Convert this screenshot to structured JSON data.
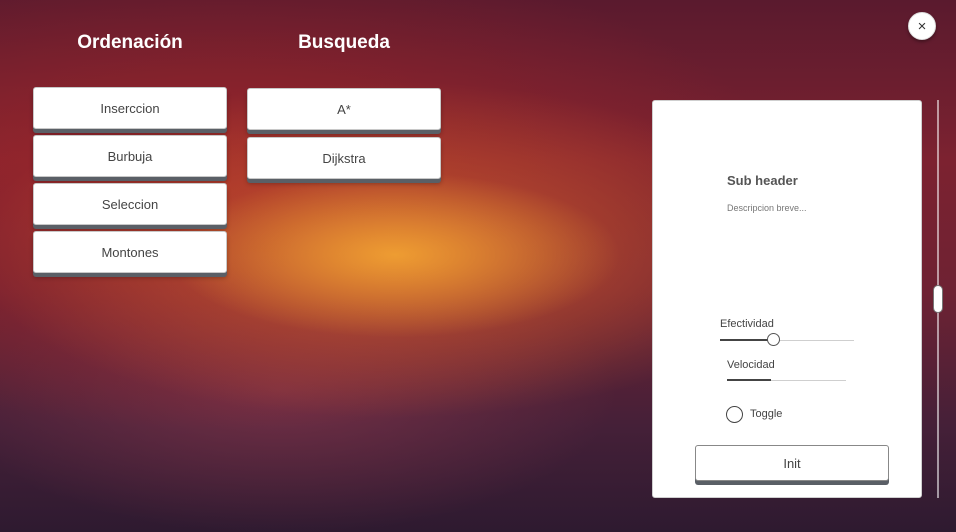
{
  "close_button": {
    "icon": "close-icon",
    "glyph": "×"
  },
  "sections": {
    "sorting": {
      "title": "Ordenación",
      "buttons": [
        "Inserccion",
        "Burbuja",
        "Seleccion",
        "Montones"
      ]
    },
    "search": {
      "title": "Busqueda",
      "buttons": [
        "A*",
        "Dijkstra"
      ]
    }
  },
  "panel": {
    "sub_header": "Sub header",
    "description": "Descripcion breve...",
    "sliders": [
      {
        "label": "Efectividad",
        "value": 0.4
      },
      {
        "label": "Velocidad",
        "value": 0.37
      }
    ],
    "toggle": {
      "label": "Toggle",
      "checked": false
    },
    "init_label": "Init"
  },
  "scrollbar": {
    "position": 0.49
  }
}
